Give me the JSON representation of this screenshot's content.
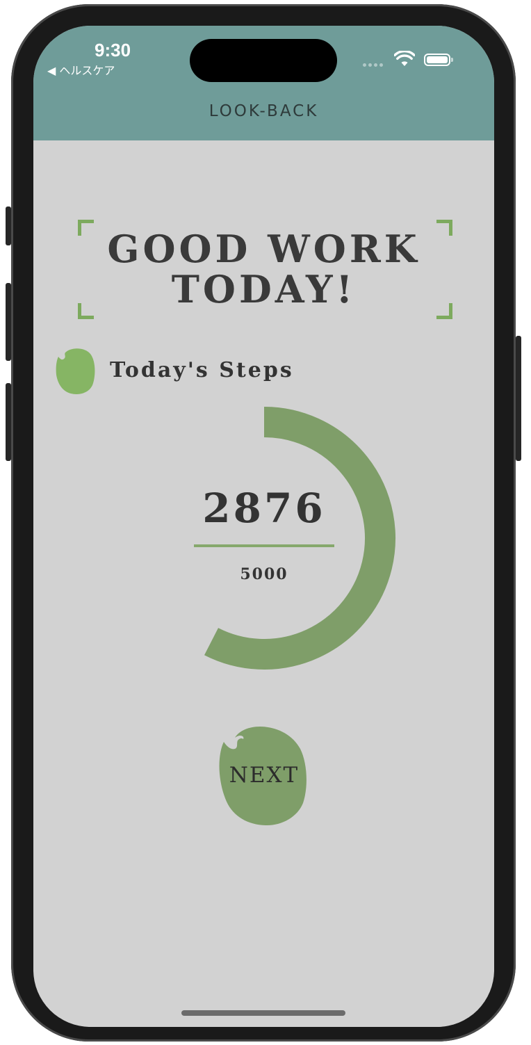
{
  "status_bar": {
    "time": "9:30",
    "back_label": "◀ ヘルスケア"
  },
  "nav": {
    "title": "LOOK-BACK"
  },
  "headline": {
    "line1": "GOOD WORK",
    "line2": "TODAY!"
  },
  "steps": {
    "label": "Today's Steps",
    "value": "2876",
    "goal": "5000",
    "progress_fraction": 0.5752
  },
  "next_button": {
    "label": "NEXT"
  },
  "colors": {
    "header_bg": "#6f9c99",
    "screen_bg": "#d2d2d2",
    "ring_green": "#7f9e69",
    "blob_green": "#86b564",
    "accent_green": "#7daa5e"
  }
}
